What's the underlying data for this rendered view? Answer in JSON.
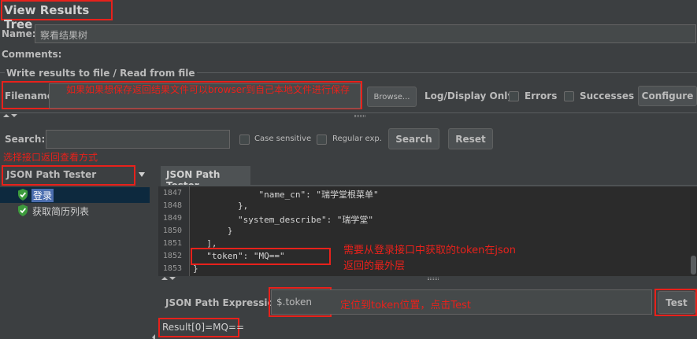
{
  "header": {
    "title": "View Results Tree"
  },
  "name_row": {
    "label": "Name:",
    "value": "察看结果树"
  },
  "comments_row": {
    "label": "Comments:"
  },
  "write_section": {
    "legend": "Write results to file / Read from file",
    "filename_label": "Filename",
    "filename_annotation": "如果如果想保存返回结果文件可以browser到自己本地文件进行保存",
    "browse_label": "Browse...",
    "log_display_label": "Log/Display Only:",
    "errors_label": "Errors",
    "successes_label": "Successes",
    "configure_label": "Configure"
  },
  "search": {
    "label": "Search:",
    "value": "",
    "case_sensitive_label": "Case sensitive",
    "regular_exp_label": "Regular exp.",
    "search_button": "Search",
    "reset_button": "Reset",
    "annotation": "选择接口返回查看方式"
  },
  "left_panel": {
    "renderer_selected": "JSON Path Tester",
    "tree_items": [
      {
        "label": "登录",
        "selected": true
      },
      {
        "label": "获取简历列表",
        "selected": false
      }
    ]
  },
  "right_panel": {
    "tab_label": "JSON Path Tester",
    "code_lines": [
      {
        "num": "1847",
        "text": "            \"name_cn\": \"瑞学堂根菜单\""
      },
      {
        "num": "1848",
        "text": "        },"
      },
      {
        "num": "1849",
        "text": "        \"system_describe\": \"瑞学堂\""
      },
      {
        "num": "1850",
        "text": "      }"
      },
      {
        "num": "1851",
        "text": "  ],"
      },
      {
        "num": "1852",
        "text": "  \"token\": \"MQ==\""
      },
      {
        "num": "1853",
        "text": "}"
      }
    ],
    "token_annotation_line1": "需要从登录接口中获取的token在json",
    "token_annotation_line2": "返回的最外层",
    "expression_label": "JSON Path Expression",
    "expression_value": "$.token",
    "expression_annotation": "定位到token位置，点击Test",
    "test_button": "Test",
    "result_text": "Result[0]=MQ=="
  },
  "colors": {
    "background": "#3c3f41",
    "annotation_red": "#e8211b",
    "selection": "#4b6eaf",
    "success_green": "#4caf50"
  }
}
